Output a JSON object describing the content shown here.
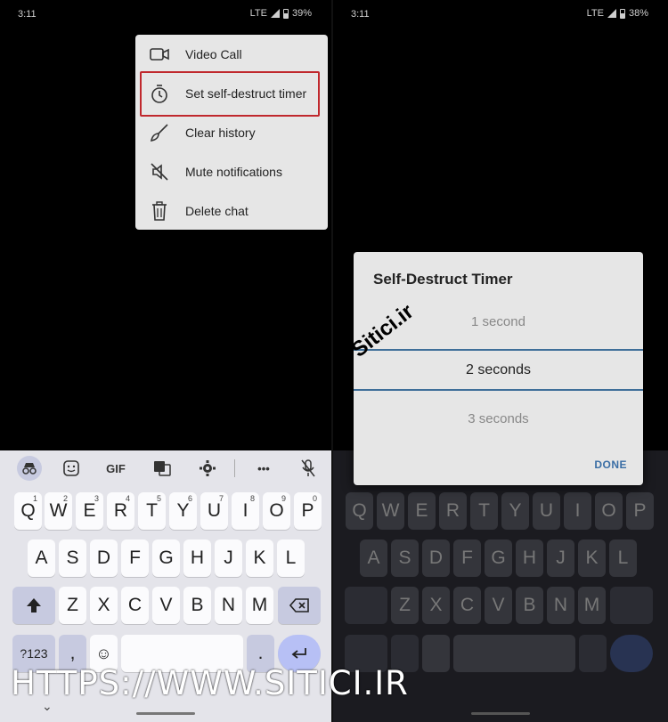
{
  "left": {
    "status": {
      "time": "3:11",
      "network": "LTE",
      "battery": "39%"
    },
    "menu": {
      "items": [
        {
          "label": "Video Call",
          "icon": "video-camera-icon"
        },
        {
          "label": "Set self-destruct timer",
          "icon": "timer-icon"
        },
        {
          "label": "Clear history",
          "icon": "broom-icon"
        },
        {
          "label": "Mute notifications",
          "icon": "speaker-muted-icon"
        },
        {
          "label": "Delete chat",
          "icon": "trash-icon"
        }
      ],
      "highlight_color": "#c0282d"
    },
    "keyboard": {
      "toolbar": {
        "gif": "GIF",
        "more": "•••"
      },
      "row1": [
        "Q",
        "W",
        "E",
        "R",
        "T",
        "Y",
        "U",
        "I",
        "O",
        "P"
      ],
      "row1_hints": [
        "1",
        "2",
        "3",
        "4",
        "5",
        "6",
        "7",
        "8",
        "9",
        "0"
      ],
      "row2": [
        "A",
        "S",
        "D",
        "F",
        "G",
        "H",
        "J",
        "K",
        "L"
      ],
      "row3": [
        "Z",
        "X",
        "C",
        "V",
        "B",
        "N",
        "M"
      ],
      "symbols": "?123",
      "comma": ",",
      "emoji": "☺",
      "period": "."
    }
  },
  "right": {
    "status": {
      "time": "3:11",
      "network": "LTE",
      "battery": "38%"
    },
    "dialog": {
      "title": "Self-Destruct Timer",
      "options": [
        "1 second",
        "2 seconds",
        "3 seconds"
      ],
      "selected": "2 seconds",
      "done": "DONE",
      "accent": "#3a6ea5"
    },
    "stamp": "Sitici.ir"
  },
  "watermark": "HTTPS://WWW.SITICI.IR"
}
